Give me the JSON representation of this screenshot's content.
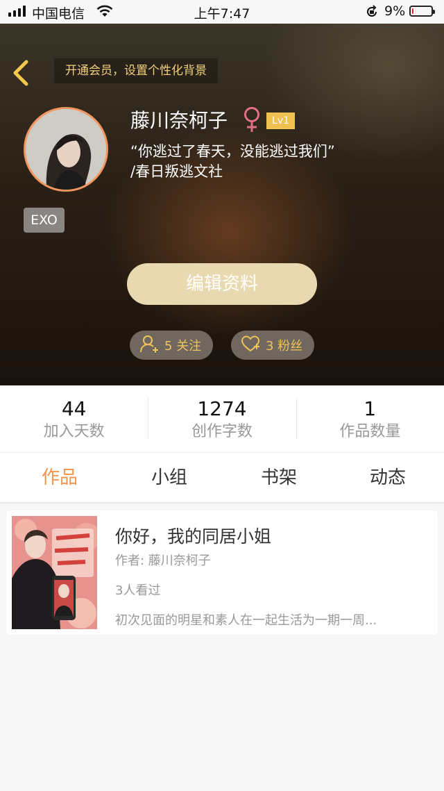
{
  "status_bar": {
    "carrier": "中国电信",
    "time": "上午7:47",
    "battery_percent": "9%",
    "battery_level": 0.09
  },
  "header": {
    "vip_promo": "开通会员，设置个性化背景"
  },
  "profile": {
    "name": "藤川奈柯子",
    "gender_symbol": "♀",
    "level": "Lv1",
    "motto_line1": "“你逃过了春天，没能逃过我们”",
    "motto_line2": "/春日叛逃文社",
    "tag": "EXO",
    "edit_label": "编辑资料",
    "following_label": "5 关注",
    "fans_label": "3 粉丝"
  },
  "stats": [
    {
      "value": "44",
      "label": "加入天数"
    },
    {
      "value": "1274",
      "label": "创作字数"
    },
    {
      "value": "1",
      "label": "作品数量"
    }
  ],
  "tabs": [
    {
      "label": "作品",
      "active": true
    },
    {
      "label": "小组",
      "active": false
    },
    {
      "label": "书架",
      "active": false
    },
    {
      "label": "动态",
      "active": false
    }
  ],
  "works": [
    {
      "title": "你好，我的同居小姐",
      "author": "作者: 藤川奈柯子",
      "views": "3人看过",
      "description": "初次见面的明星和素人在一起生活为一期一周..."
    }
  ],
  "colors": {
    "accent": "#f2934e",
    "gold": "#f0c35a",
    "level_badge": "#efc052",
    "edit_button": "#e8d9b0"
  }
}
